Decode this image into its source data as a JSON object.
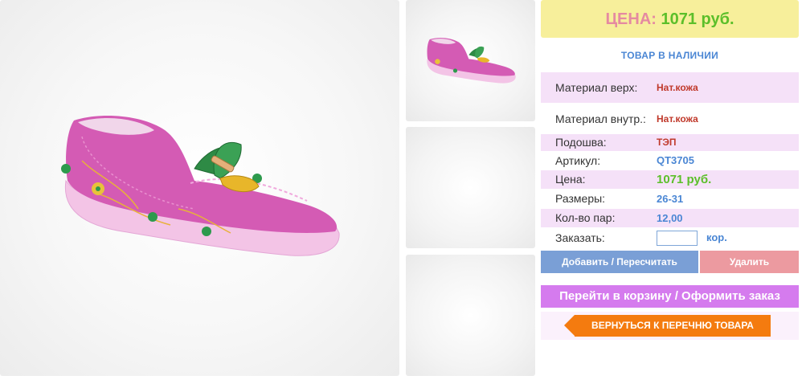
{
  "product": {
    "price_label": "ЦЕНА:",
    "price_value": "1071 руб.",
    "stock_status": "ТОВАР В НАЛИЧИИ",
    "colors": {
      "price_box": "#f7ef9b",
      "price_label": "#e58aa1",
      "price_value": "#5cbf2a",
      "row_highlight": "#f5e1f8",
      "accent_blue": "#4a86d4"
    }
  },
  "gallery": {
    "main_image": "pink-moccasin-photo",
    "thumbnails": [
      "pink-moccasin-photo",
      "empty",
      "empty"
    ]
  },
  "specs": [
    {
      "label": "Материал верх:",
      "value": "Нат.кожа"
    },
    {
      "label": "Материал внутр.:",
      "value": "Нат.кожа"
    },
    {
      "label": "Подошва:",
      "value": "ТЭП"
    },
    {
      "label": "Артикул:",
      "value": "QT3705"
    },
    {
      "label": "Цена:",
      "value": "1071 руб."
    },
    {
      "label": "Размеры:",
      "value": "26-31"
    },
    {
      "label": "Кол-во пар:",
      "value": "12,00"
    }
  ],
  "order": {
    "label": "Заказать:",
    "quantity": "",
    "unit": "кор."
  },
  "buttons": {
    "add": "Добавить / Пересчитать",
    "delete": "Удалить",
    "cart": "Перейти в корзину / Оформить заказ",
    "back": "ВЕРНУТЬСЯ К ПЕРЕЧНЮ ТОВАРА"
  }
}
